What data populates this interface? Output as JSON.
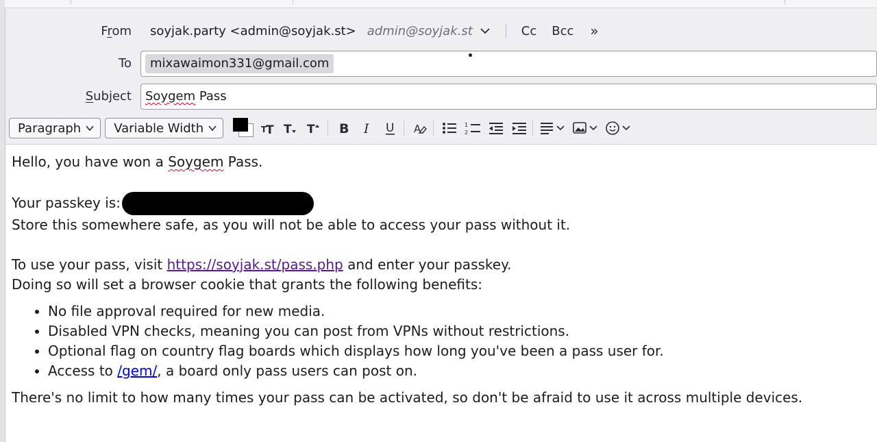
{
  "header": {
    "from_label_pre": "F",
    "from_label_u": "r",
    "from_label_post": "om",
    "from_value": "soyjak.party <admin@soyjak.st>",
    "from_identity": "admin@soyjak.st",
    "cc_label": "Cc",
    "bcc_label": "Bcc",
    "more_label": "»",
    "to_label": "To",
    "to_recipient": "mixawaimon331@gmail.com",
    "subject_label_u": "S",
    "subject_label_post": "ubject",
    "subject_word_misspelled": "Soygem",
    "subject_rest": " Pass"
  },
  "toolbar": {
    "paragraph_format": "Paragraph",
    "font_family": "Variable Width",
    "text_color": "#000000",
    "bg_color": "#ffffff"
  },
  "body": {
    "greeting_pre": "Hello, you have won a ",
    "greeting_word": "Soygem",
    "greeting_post": " Pass.",
    "passkey_label": "Your passkey is:",
    "store_note": "Store this somewhere safe, as you will not be able to access your pass without it.",
    "visit_pre": "To use your pass, visit ",
    "visit_link": "https://soyjak.st/pass.php",
    "visit_post": " and enter your passkey.",
    "cookie_note": "Doing so will set a browser cookie that grants the following benefits:",
    "benefits": [
      "No file approval required for new media.",
      "Disabled VPN checks, meaning you can post from VPNs without restrictions.",
      "Optional flag on country flag boards which displays how long you've been a pass user for."
    ],
    "benefit4_pre": "Access to ",
    "benefit4_link": "/gem/",
    "benefit4_post": ", a board only pass users can post on.",
    "closing": "There's no limit to how many times your pass can be activated, so don't be afraid to use it across multiple devices."
  }
}
